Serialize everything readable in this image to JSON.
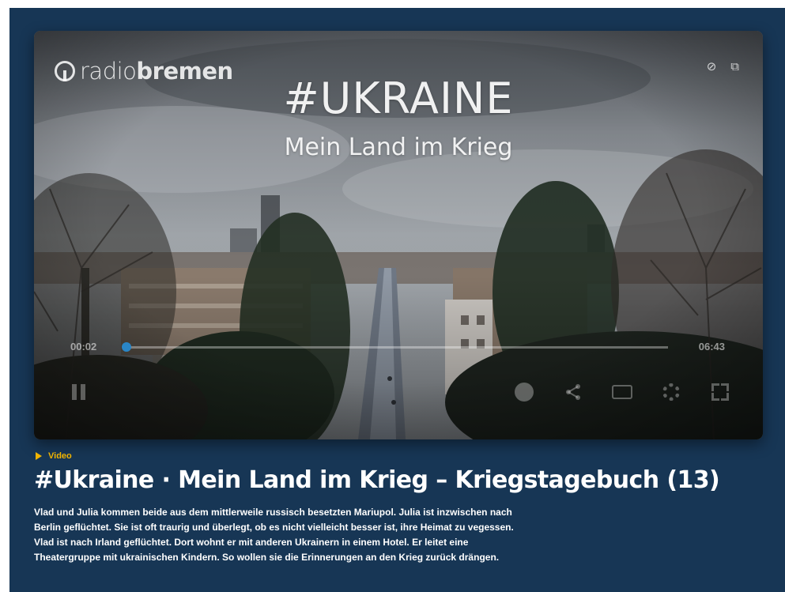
{
  "player": {
    "brand_light": "radio",
    "brand_bold": "bremen",
    "title": "#UKRAINE",
    "subtitle": "Mein Land im Krieg",
    "current_time": "00:02",
    "total_time": "06:43",
    "progress_percent": 0.5,
    "icons": {
      "top": [
        "audio-description-off-icon",
        "picture-in-picture-icon"
      ],
      "left": [
        "pause-icon"
      ],
      "right": [
        "info-icon",
        "share-icon",
        "subtitles-icon",
        "settings-icon",
        "fullscreen-icon"
      ]
    }
  },
  "article": {
    "kicker": "Video",
    "headline": "#Ukraine · Mein Land im Krieg – Kriegstagebuch (13)",
    "teaser": "Vlad und Julia kommen beide aus dem mittlerweile russisch besetzten Mariupol. Julia ist inzwischen nach Berlin geflüchtet. Sie ist oft traurig und überlegt, ob es nicht vielleicht besser ist, ihre Heimat zu vegessen. Vlad ist nach Irland geflüchtet. Dort wohnt er mit anderen Ukrainern in einem Hotel. Er leitet eine Theatergruppe mit ukrainischen Kindern. So wollen sie die Erinnerungen an den Krieg zurück drängen."
  },
  "colors": {
    "page_background": "#173655",
    "kicker": "#f0b400",
    "progress": "#2a86c7"
  }
}
